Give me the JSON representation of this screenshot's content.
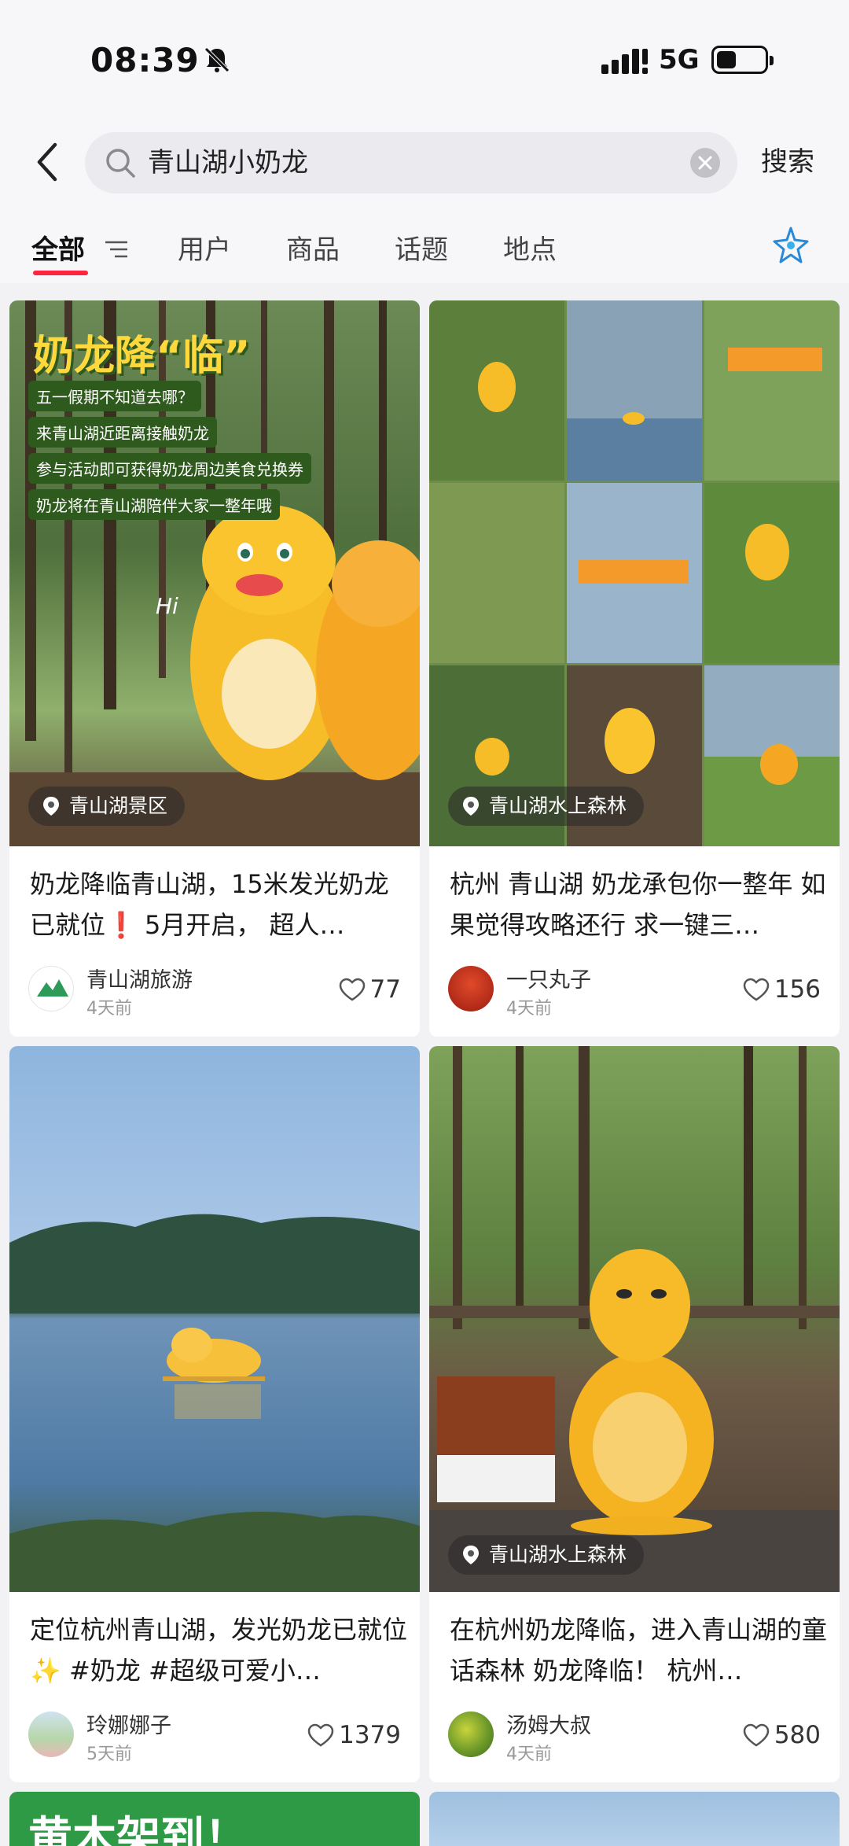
{
  "status": {
    "time": "08:39",
    "network": "5G"
  },
  "search": {
    "query": "青山湖小奶龙",
    "button": "搜索"
  },
  "tabs": [
    "全部",
    "用户",
    "商品",
    "话题",
    "地点"
  ],
  "colors": {
    "accent": "#ff2442",
    "background": "#f2f2f4"
  },
  "cards": [
    {
      "title": "奶龙降临青山湖，15米发光奶龙已就位❗ 5月开启， 超人…",
      "image_text": {
        "headline": "奶龙降“临”",
        "lines": [
          "五一假期不知道去哪？",
          "来青山湖近距离接触奶龙",
          "参与活动即可获得奶龙周边美食兑换券",
          "奶龙将在青山湖陪伴大家一整年哦"
        ],
        "hi": "Hi"
      },
      "location": "青山湖景区",
      "author": "青山湖旅游",
      "date": "4天前",
      "likes": "77"
    },
    {
      "title": "杭州 青山湖 奶龙承包你一整年 如果觉得攻略还行 求一键三…",
      "location": "青山湖水上森林",
      "author": "一只丸子",
      "date": "4天前",
      "likes": "156"
    },
    {
      "title": "定位杭州青山湖，发光奶龙已就位✨ #奶龙 #超级可爱小…",
      "author": "玲娜娜子",
      "date": "5天前",
      "likes": "1379"
    },
    {
      "title": "在杭州奶龙降临，进入青山湖的童话森林 奶龙降临！ 杭州…",
      "location": "青山湖水上森林",
      "author": "汤姆大叔",
      "date": "4天前",
      "likes": "580"
    }
  ],
  "partial_card": {
    "headline": "黄木架到！"
  }
}
